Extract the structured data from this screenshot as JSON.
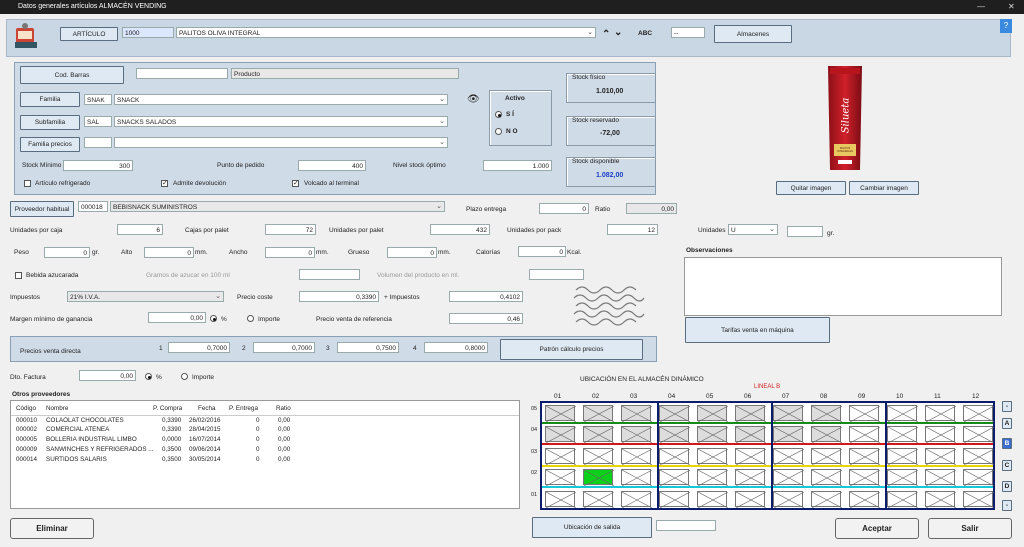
{
  "window": {
    "title": "Datos generales artículos ALMACÉN VENDING"
  },
  "header": {
    "articulo_button": "ARTÍCULO",
    "article_code": "1000",
    "article_name": "PALITOS OLIVA INTEGRAL",
    "abc_label": "ABC",
    "abc_value": "--",
    "almacenes_button": "Almacenes"
  },
  "form": {
    "cod_barras_button": "Cod. Barras",
    "cod_barras_value": "",
    "producto_value": "Producto",
    "familia_button": "Familia",
    "familia_code": "SNAK",
    "familia_name": "SNACK",
    "subfamilia_button": "Subfamilia",
    "subfamilia_code": "SAL",
    "subfamilia_name": "SNACKS SALADOS",
    "familia_precios_button": "Familia precios",
    "familia_precios_code": "",
    "familia_precios_name": "",
    "activo_title": "Activo",
    "activo_si": "S Í",
    "activo_no": "N O",
    "stock_minimo_label": "Stock Mínimo",
    "stock_minimo_value": "300",
    "punto_pedido_label": "Punto de pedido",
    "punto_pedido_value": "400",
    "nivel_stock_label": "Nivel stock óptimo",
    "nivel_stock_value": "1.000",
    "refrigerado_label": "Artículo refrigerado",
    "refrigerado_checked": false,
    "devolucion_label": "Admite devolución",
    "devolucion_checked": true,
    "volcado_label": "Volcado al terminal",
    "volcado_checked": true,
    "stock_fisico_label": "Stock físico",
    "stock_fisico_value": "1.010,00",
    "stock_reservado_label": "Stock reservado",
    "stock_reservado_value": "-72,00",
    "stock_disponible_label": "Stock disponible",
    "stock_disponible_value": "1.082,00",
    "quitar_imagen_button": "Quitar imagen",
    "cambiar_imagen_button": "Cambiar imagen",
    "product_image_text": "Silueta",
    "product_image_subtext": "PALITOS INTEGRALES",
    "proveedor_button": "Proveedor habitual",
    "proveedor_code": "000018",
    "proveedor_name": "BEBISNACK SUMINISTROS",
    "plazo_entrega_label": "Plazo entrega",
    "plazo_entrega_value": "0",
    "ratio_label": "Ratio",
    "ratio_value": "0,00",
    "unidades_caja_label": "Unidades por caja",
    "unidades_caja_value": "6",
    "cajas_palet_label": "Cajas por palet",
    "cajas_palet_value": "72",
    "unidades_palet_label": "Unidades por palet",
    "unidades_palet_value": "432",
    "unidades_pack_label": "Unidades por pack",
    "unidades_pack_value": "12",
    "unidades_label": "Unidades",
    "unidades_value": "U",
    "gr_value": "",
    "gr_label": "gr.",
    "peso_label": "Peso",
    "peso_value": "0",
    "peso_unit": "gr.",
    "alto_label": "Alto",
    "alto_value": "0",
    "alto_unit": "mm.",
    "ancho_label": "Ancho",
    "ancho_value": "0",
    "ancho_unit": "mm.",
    "grueso_label": "Grueso",
    "grueso_value": "0",
    "grueso_unit": "mm.",
    "calorias_label": "Calorías",
    "calorias_value": "0",
    "calorias_unit": "Kcal.",
    "bebida_label": "Bebida azucarada",
    "gramos_azucar_label": "Gramos de azucar en 100 ml",
    "volumen_label": "Volumen del producto en ml.",
    "observaciones_label": "Observaciones",
    "impuestos_label": "Impuestos",
    "impuestos_value": "21% I.V.A.",
    "precio_coste_label": "Precio coste",
    "precio_coste_value": "0,3390",
    "mas_impuestos_label": "+ Impuestos",
    "mas_impuestos_value": "0,4102",
    "margen_label": "Margen mínimo de ganancia",
    "margen_value": "0,00",
    "pct_label": "%",
    "importe_label": "Importe",
    "pvr_label": "Precio venta de referencia",
    "pvr_value": "0,46",
    "tarifas_button": "Tarifas venta en máquina",
    "pvd_label": "Precios venta directa",
    "pvd": [
      {
        "n": "1",
        "v": "0,7000"
      },
      {
        "n": "2",
        "v": "0,7000"
      },
      {
        "n": "3",
        "v": "0,7500"
      },
      {
        "n": "4",
        "v": "0,8000"
      }
    ],
    "patron_button": "Patrón cálculo precios",
    "dto_label": "Dto. Factura",
    "dto_value": "0,00",
    "dto_pct": "%",
    "dto_importe": "Importe"
  },
  "otros": {
    "title": "Otros proveedores",
    "headers": [
      "Código",
      "Nombre",
      "P. Compra",
      "Fecha",
      "P. Entrega",
      "Ratio"
    ],
    "rows": [
      [
        "000010",
        "COLAOLAT CHOCOLATES",
        "0,3390",
        "26/02/2016",
        "0",
        "0,00"
      ],
      [
        "000002",
        "COMERCIAL ATENEA",
        "0,3390",
        "28/04/2015",
        "0",
        "0,00"
      ],
      [
        "000005",
        "BOLLERIA INDUSTRIAL LIMBO",
        "0,0000",
        "16/07/2014",
        "0",
        "0,00"
      ],
      [
        "000009",
        "SANWINCHES Y REFRIGERADOS ...",
        "0,3500",
        "09/06/2014",
        "0",
        "0,00"
      ],
      [
        "000014",
        "SURTIDOS SALARIS",
        "0,3500",
        "30/05/2014",
        "0",
        "0,00"
      ]
    ]
  },
  "ubicacion": {
    "title": "UBICACIÓN EN EL ALMACÉN DINÁMICO",
    "lineal": "LINEAL  B",
    "cols": [
      "01",
      "02",
      "03",
      "04",
      "05",
      "06",
      "07",
      "08",
      "09",
      "10",
      "11",
      "12"
    ],
    "rows": [
      "05",
      "04",
      "03",
      "02",
      "01"
    ],
    "side_buttons": [
      "-",
      "A",
      "B",
      "C",
      "D",
      "-"
    ],
    "salida_button": "Ubicación de salida",
    "salida_value": ""
  },
  "footer": {
    "eliminar": "Eliminar",
    "aceptar": "Aceptar",
    "salir": "Salir"
  }
}
